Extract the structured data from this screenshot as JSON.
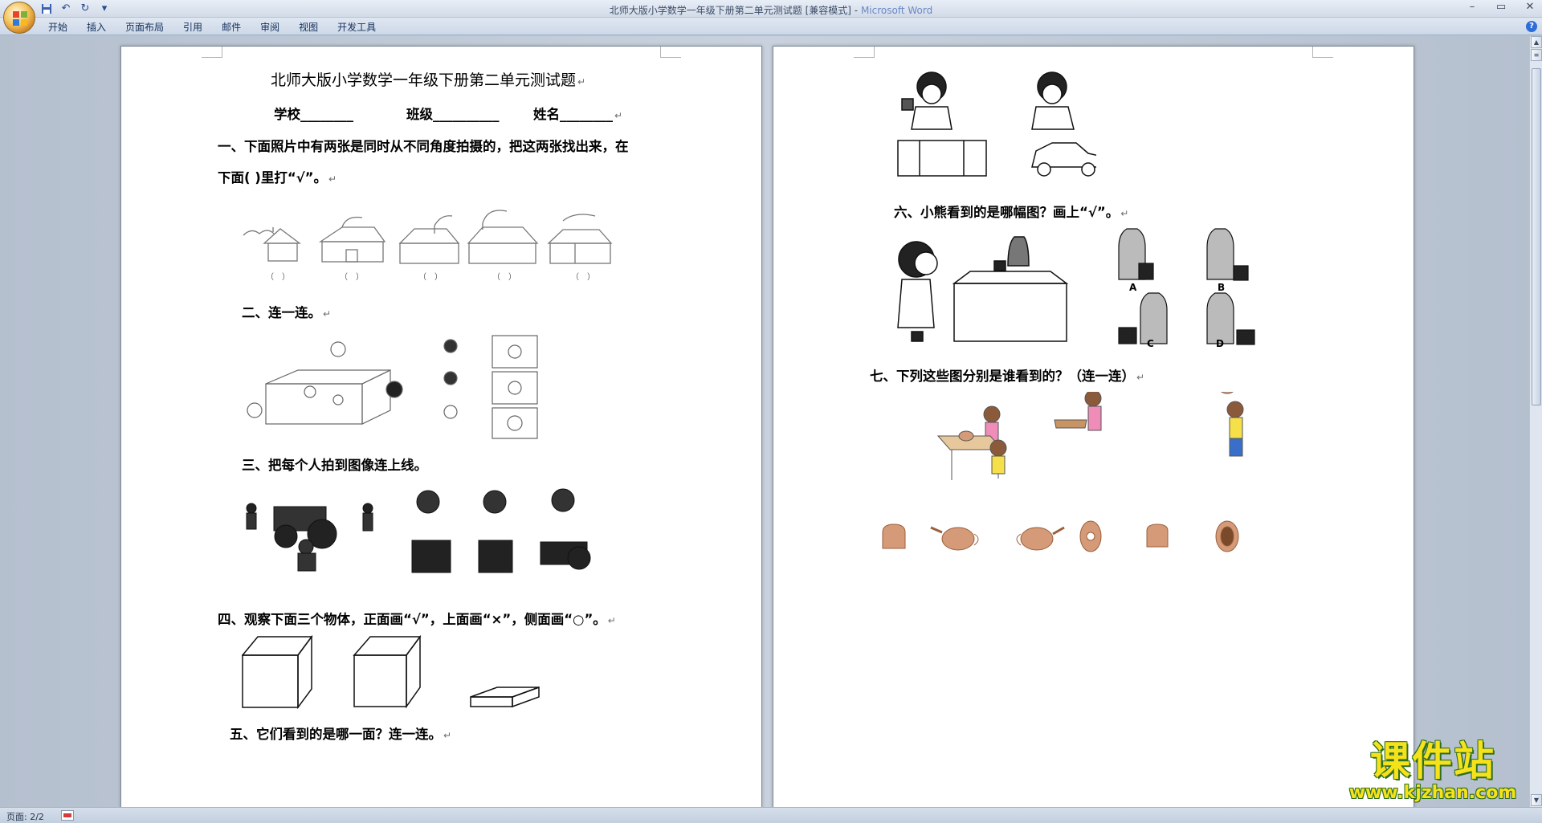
{
  "window": {
    "doc_title": "北师大版小学数学一年级下册第二单元测试题 [兼容模式]",
    "app_name": "Microsoft Word",
    "qat": {
      "save_icon": "save-icon",
      "undo_icon": "undo-icon",
      "redo_icon": "redo-icon",
      "customize_icon": "customize-icon"
    }
  },
  "ribbon": {
    "tabs": [
      "开始",
      "插入",
      "页面布局",
      "引用",
      "邮件",
      "审阅",
      "视图",
      "开发工具"
    ],
    "help_label": "?"
  },
  "page1": {
    "title": "北师大版小学数学一年级下册第二单元测试题",
    "school_label": "学校________",
    "class_label": "班级__________",
    "name_label": "姓名________",
    "q1_line1": "一、下面照片中有两张是同时从不同角度拍摄的，把这两张找出来，在",
    "q1_line2": "下面( )里打“√”。",
    "q1_parens": [
      "（　）",
      "（　）",
      "（　）",
      "（　）",
      "（　）"
    ],
    "q2": "二、连一连。",
    "q3": "三、把每个人拍到图像连上线。",
    "q4": "四、观察下面三个物体，正面画“√”，上面画“×”，侧面画“○”。",
    "q5": "五、它们看到的是哪一面？连一连。"
  },
  "page2": {
    "q6": "六、小熊看到的是哪幅图？画上“√”。",
    "q6_options": [
      "A",
      "B",
      "C",
      "D"
    ],
    "q7": "七、下列这些图分别是谁看到的？（连一连）"
  },
  "paragraph_mark": "↵",
  "statusbar": {
    "page_info": "页面: 2/2"
  },
  "watermark": {
    "main": "课件站",
    "url": "www.kjzhan.com"
  },
  "colors": {
    "workspace": "#b8c3d2",
    "teapot": "#d59a77",
    "watermark_text": "#f5e21a",
    "watermark_outline": "#2e6e1d"
  }
}
